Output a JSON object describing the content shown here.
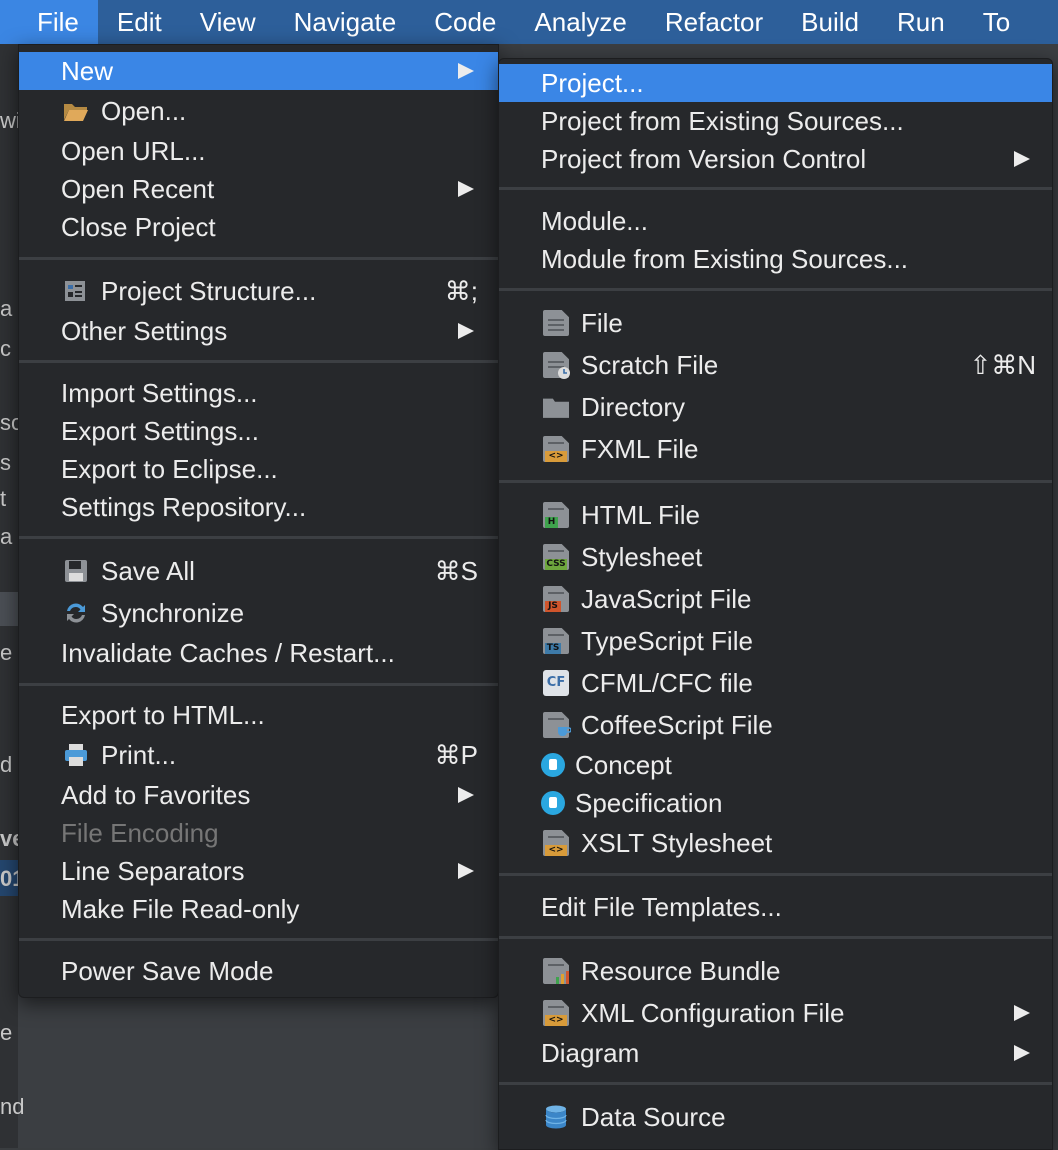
{
  "menubar": {
    "items": [
      "File",
      "Edit",
      "View",
      "Navigate",
      "Code",
      "Analyze",
      "Refactor",
      "Build",
      "Run",
      "To"
    ]
  },
  "background": {
    "fragments": [
      "wi",
      "a",
      "c",
      "so",
      "s",
      "t",
      "a",
      "e",
      "d",
      "ve",
      "01",
      "e",
      "nd"
    ]
  },
  "file_menu": {
    "new": "New",
    "open": "Open...",
    "open_url": "Open URL...",
    "open_recent": "Open Recent",
    "close_project": "Close Project",
    "project_structure": "Project Structure...",
    "project_structure_shortcut": "⌘;",
    "other_settings": "Other Settings",
    "import_settings": "Import Settings...",
    "export_settings": "Export Settings...",
    "export_eclipse": "Export to Eclipse...",
    "settings_repo": "Settings Repository...",
    "save_all": "Save All",
    "save_all_shortcut": "⌘S",
    "synchronize": "Synchronize",
    "invalidate": "Invalidate Caches / Restart...",
    "export_html": "Export to HTML...",
    "print": "Print...",
    "print_shortcut": "⌘P",
    "add_favorites": "Add to Favorites",
    "file_encoding": "File Encoding",
    "line_separators": "Line Separators",
    "read_only": "Make File Read-only",
    "power_save": "Power Save Mode"
  },
  "new_menu": {
    "project": "Project...",
    "project_existing": "Project from Existing Sources...",
    "project_vcs": "Project from Version Control",
    "module": "Module...",
    "module_existing": "Module from Existing Sources...",
    "file": "File",
    "scratch": "Scratch File",
    "scratch_shortcut": "⇧⌘N",
    "directory": "Directory",
    "fxml": "FXML File",
    "html": "HTML File",
    "stylesheet": "Stylesheet",
    "javascript": "JavaScript File",
    "typescript": "TypeScript File",
    "cfml": "CFML/CFC file",
    "coffeescript": "CoffeeScript File",
    "concept": "Concept",
    "specification": "Specification",
    "xslt": "XSLT Stylesheet",
    "edit_templates": "Edit File Templates...",
    "resource_bundle": "Resource Bundle",
    "xml_config": "XML Configuration File",
    "diagram": "Diagram",
    "data_source": "Data Source"
  },
  "icons": {
    "open": "folder-open-icon",
    "project_structure": "project-structure-icon",
    "save_all": "floppy-disk-icon",
    "synchronize": "sync-icon",
    "print": "printer-icon",
    "file": "file-icon",
    "scratch": "scratch-file-icon",
    "directory": "folder-icon",
    "fxml": "fxml-file-icon",
    "html": "html-file-icon",
    "stylesheet": "css-file-icon",
    "javascript": "js-file-icon",
    "typescript": "ts-file-icon",
    "cfml": "cf-file-icon",
    "coffeescript": "coffee-file-icon",
    "concept": "concept-icon",
    "specification": "specification-icon",
    "xslt": "xslt-file-icon",
    "resource_bundle": "resource-bundle-icon",
    "xml_config": "xml-file-icon",
    "data_source": "database-icon"
  },
  "colors": {
    "menubar": "#2d5f9a",
    "highlight": "#3a86e6",
    "menu_bg": "#26282b",
    "html_badge": "#3fa34d",
    "css_badge": "#6ea73d",
    "js_badge": "#d0552c",
    "ts_badge": "#3d7aa8",
    "xml_badge": "#d89b3a",
    "concept": "#2aa7e0"
  }
}
